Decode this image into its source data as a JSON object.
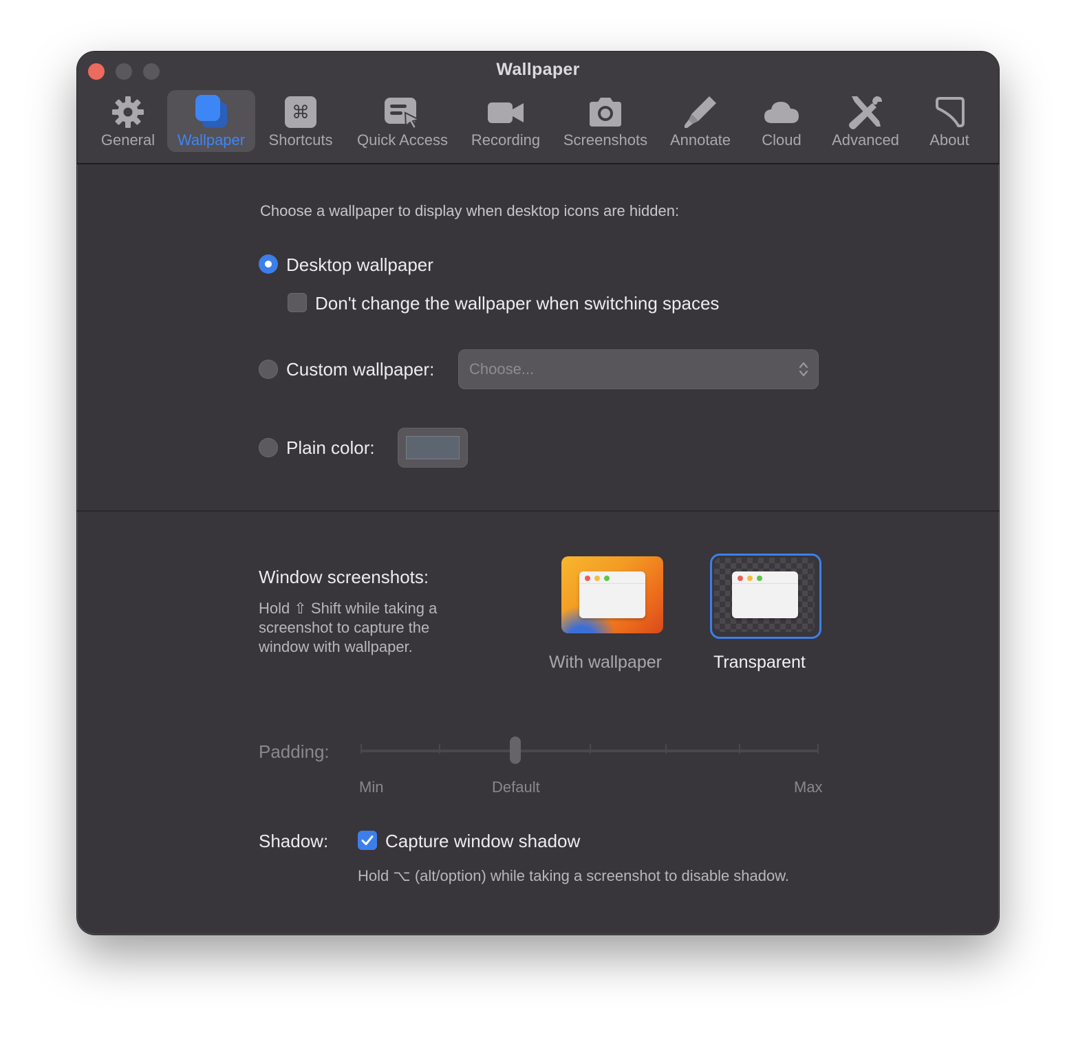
{
  "window": {
    "title": "Wallpaper"
  },
  "tabs": [
    {
      "label": "General",
      "icon": "gear-icon"
    },
    {
      "label": "Wallpaper",
      "icon": "wallpaper-icon",
      "active": true
    },
    {
      "label": "Shortcuts",
      "icon": "command-key-icon"
    },
    {
      "label": "Quick Access",
      "icon": "quick-access-icon"
    },
    {
      "label": "Recording",
      "icon": "video-camera-icon"
    },
    {
      "label": "Screenshots",
      "icon": "camera-icon"
    },
    {
      "label": "Annotate",
      "icon": "highlighter-icon"
    },
    {
      "label": "Cloud",
      "icon": "cloud-icon"
    },
    {
      "label": "Advanced",
      "icon": "tools-icon"
    },
    {
      "label": "About",
      "icon": "about-icon"
    }
  ],
  "wallpaper": {
    "intro": "Choose a wallpaper to display when desktop icons are hidden:",
    "desktop_option": "Desktop wallpaper",
    "desktop_selected": true,
    "dont_change_label": "Don't change the wallpaper when switching spaces",
    "dont_change_checked": false,
    "custom_option": "Custom wallpaper:",
    "custom_placeholder": "Choose...",
    "plain_option": "Plain color:",
    "plain_color": "#5d6570"
  },
  "window_screenshots": {
    "title": "Window screenshots:",
    "description": "Hold ⇧ Shift while taking a screenshot to capture the window with wallpaper.",
    "options": [
      {
        "label": "With wallpaper",
        "selected": false
      },
      {
        "label": "Transparent",
        "selected": true
      }
    ]
  },
  "padding": {
    "label": "Padding:",
    "min_label": "Min",
    "default_label": "Default",
    "max_label": "Max",
    "enabled": false
  },
  "shadow": {
    "label": "Shadow:",
    "checkbox_label": "Capture window shadow",
    "checked": true,
    "hint": "Hold ⌥ (alt/option) while taking a screenshot to disable shadow."
  },
  "colors": {
    "accent": "#3d7fea",
    "traffic_close": "#ed6a5e",
    "window_bg": "#38353b"
  }
}
